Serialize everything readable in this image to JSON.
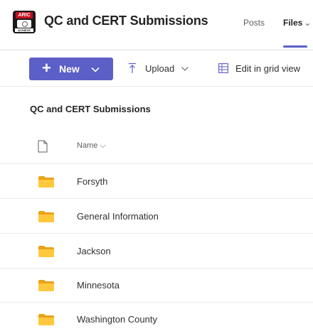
{
  "header": {
    "logo_text": "ARIC",
    "logo_subtext": "ACHIEVE",
    "team_title": "QC and CERT Submissions",
    "tabs": [
      {
        "label": "Posts",
        "active": false
      },
      {
        "label": "Files",
        "active": true
      }
    ],
    "tab_chevron": "⌄"
  },
  "toolbar": {
    "new_label": "New",
    "upload_label": "Upload",
    "grid_label": "Edit in grid view"
  },
  "library": {
    "title": "QC and CERT Submissions",
    "column_name": "Name",
    "sort_indicator": "⌵",
    "rows": [
      {
        "name": "Forsyth",
        "type": "folder"
      },
      {
        "name": "General Information",
        "type": "folder"
      },
      {
        "name": "Jackson",
        "type": "folder"
      },
      {
        "name": "Minnesota",
        "type": "folder"
      },
      {
        "name": "Washington County",
        "type": "folder"
      }
    ]
  },
  "colors": {
    "accent": "#5b5fc7",
    "folder": "#ffc83d",
    "folder_back": "#e8a317",
    "divider": "#edebe9",
    "logo_red": "#c50f1f"
  },
  "icons": {
    "logo": "team-logo-icon",
    "new_plus": "plus-icon",
    "new_chevron": "chevron-down-icon",
    "upload": "upload-icon",
    "upload_chevron": "chevron-down-icon",
    "grid": "grid-view-icon",
    "document": "document-icon",
    "folder": "folder-icon"
  }
}
